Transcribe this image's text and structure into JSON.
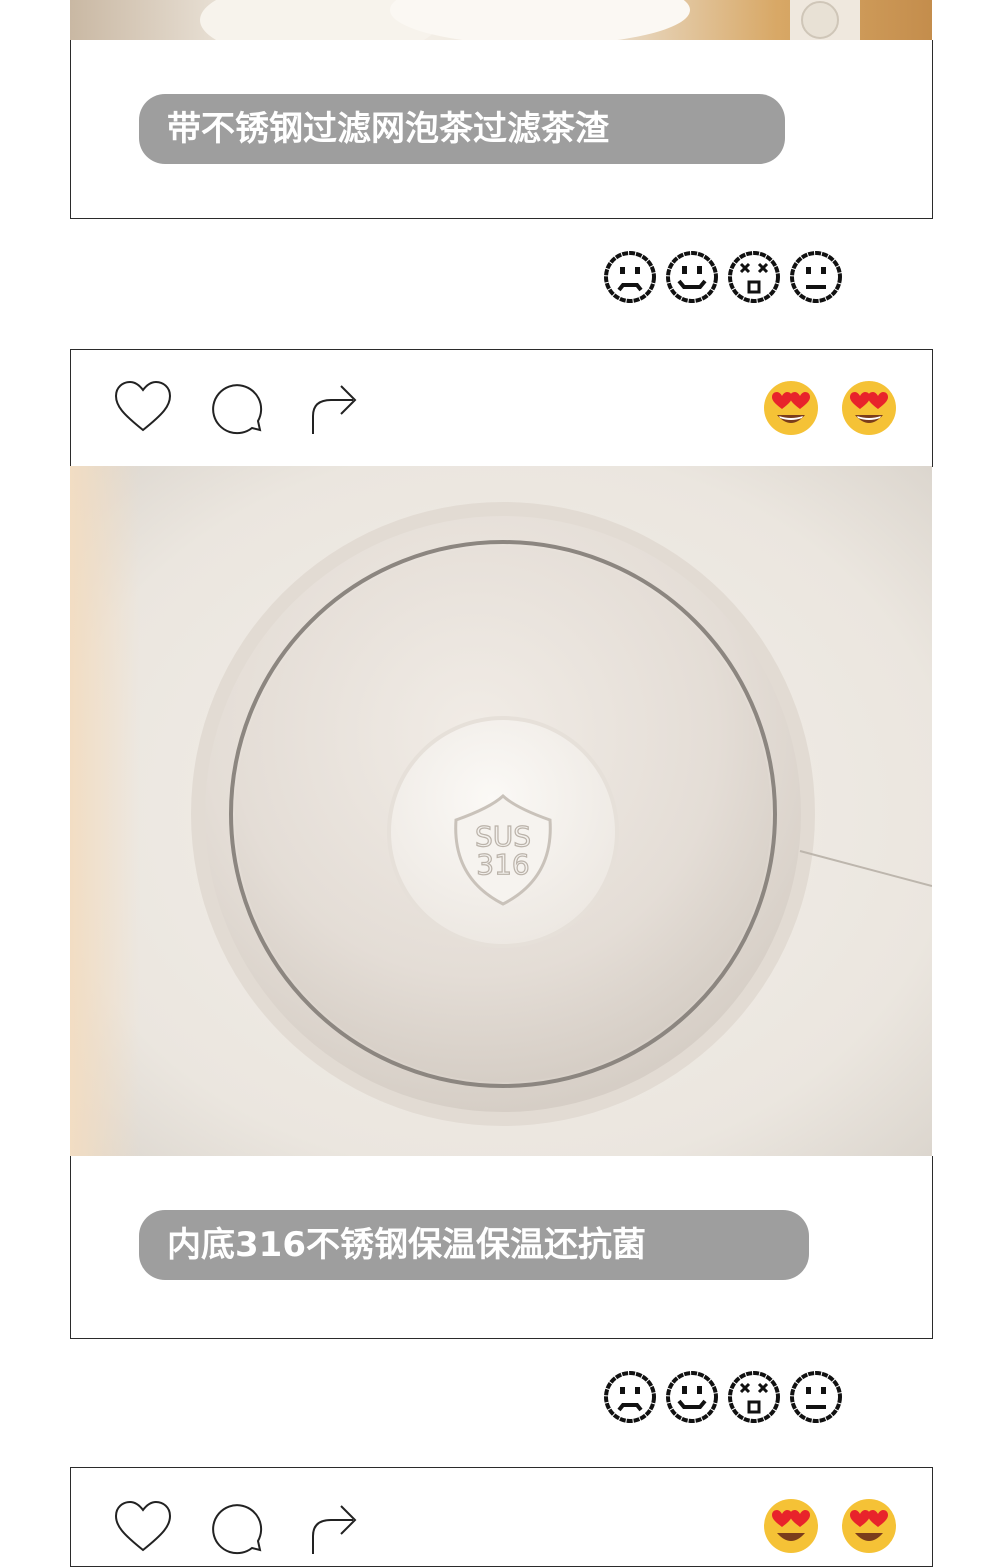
{
  "captions": {
    "first": "带不锈钢过滤网泡茶过滤茶渣",
    "second": "内底316不锈钢保温保温还抗菌"
  },
  "photo": {
    "embossed_mark_line1": "SUS",
    "embossed_mark_line2": "316"
  },
  "reaction_faces": [
    "sad-face-icon",
    "smile-face-icon",
    "dizzy-face-icon",
    "neutral-face-icon"
  ],
  "action_icons": [
    "heart-icon",
    "comment-icon",
    "share-icon"
  ],
  "reaction_emojis": [
    "heart-eyes-emoji",
    "heart-eyes-emoji"
  ],
  "colors": {
    "bubble": "#9e9e9e",
    "frame_border": "#2b2b2b",
    "emoji_yellow": "#f5c236",
    "emoji_heart": "#e8232b"
  }
}
